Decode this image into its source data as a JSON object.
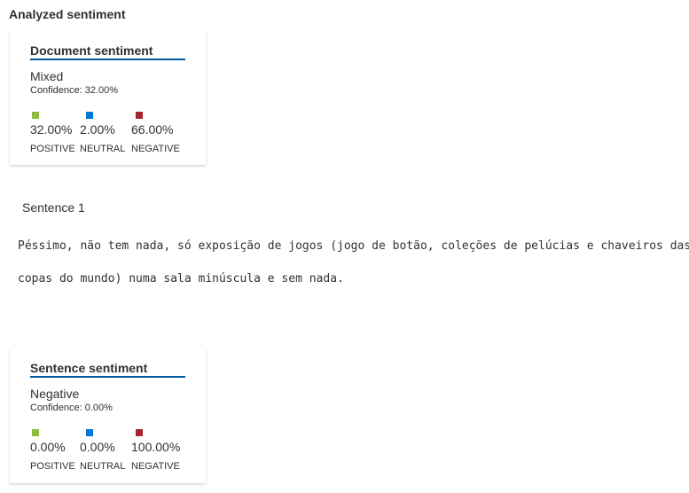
{
  "section": {
    "title": "Analyzed sentiment"
  },
  "colors": {
    "positive": "#8cbd3f",
    "neutral": "#0078d4",
    "negative": "#a4262c",
    "header_underline": "#005a9e"
  },
  "document_card": {
    "title": "Document sentiment",
    "label": "Mixed",
    "confidence": "Confidence: 32.00%",
    "metrics": [
      {
        "value": "32.00%",
        "name": "POSITIVE"
      },
      {
        "value": "2.00%",
        "name": "NEUTRAL"
      },
      {
        "value": "66.00%",
        "name": "NEGATIVE"
      }
    ]
  },
  "sentence": {
    "title": "Sentence 1",
    "text_line1": "Péssimo, não tem nada, só exposição de jogos (jogo de botão, coleções de pelúcias e chaveiros das",
    "text_line2": "copas do mundo) numa sala minúscula e sem nada."
  },
  "sentence_card": {
    "title": "Sentence sentiment",
    "label": "Negative",
    "confidence": "Confidence: 0.00%",
    "metrics": [
      {
        "value": "0.00%",
        "name": "POSITIVE"
      },
      {
        "value": "0.00%",
        "name": "NEUTRAL"
      },
      {
        "value": "100.00%",
        "name": "NEGATIVE"
      }
    ]
  }
}
